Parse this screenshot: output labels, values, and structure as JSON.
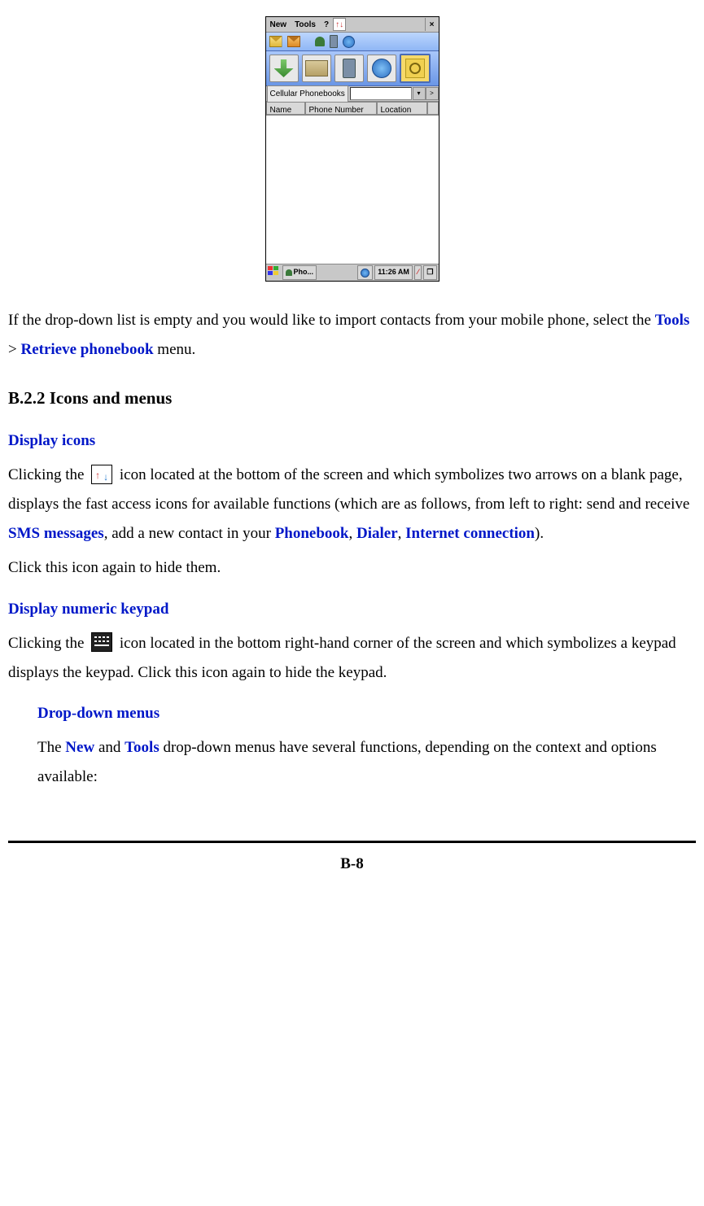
{
  "pda": {
    "menubar": {
      "new": "New",
      "tools": "Tools",
      "help": "?",
      "close": "×"
    },
    "dropdown": {
      "label": "Cellular Phonebooks",
      "chevron": ">"
    },
    "columns": {
      "name": "Name",
      "phone": "Phone Number",
      "location": "Location"
    },
    "taskbar": {
      "app": "Pho...",
      "time": "11:26 AM"
    }
  },
  "body": {
    "p1a": "If the drop-down list is empty and you would like to import contacts from your mobile phone, select the ",
    "tools": "Tools",
    "gt": " > ",
    "retrieve": "Retrieve phonebook",
    "p1b": " menu.",
    "h2": "B.2.2 Icons and menus",
    "sub1": "Display icons",
    "p2a": "Clicking the ",
    "p2b": " icon located at the bottom of the screen and which symbolizes two arrows on a blank page, displays the fast access icons for available functions (which are as follows, from left to right: send and receive ",
    "sms": "SMS messages",
    "p2c": ", add a new contact in your ",
    "phonebook": "Phonebook",
    "comma1": ", ",
    "dialer": "Dialer",
    "comma2": ", ",
    "internet": "Internet connection",
    "p2d": ").",
    "p2e": "Click this icon again to hide them.",
    "sub2": "Display numeric keypad",
    "p3a": "Clicking the ",
    "p3b": " icon located in the bottom right-hand corner of the screen and which symbolizes a keypad displays the keypad. Click this icon again to hide the keypad.",
    "sub3": "Drop-down menus",
    "p4a": "The ",
    "new": "New",
    "p4b": " and ",
    "tools2": "Tools",
    "p4c": " drop-down menus have several functions, depending on the context and options available:",
    "pagenum": "B-8"
  }
}
